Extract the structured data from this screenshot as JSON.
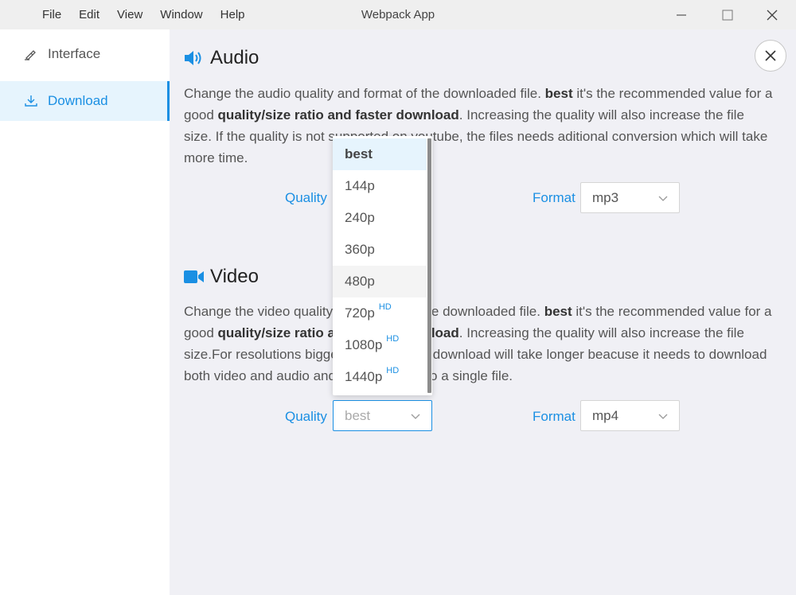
{
  "window": {
    "title": "Webpack App",
    "menu": [
      "File",
      "Edit",
      "View",
      "Window",
      "Help"
    ]
  },
  "sidebar": {
    "items": [
      {
        "label": "Interface",
        "icon": "brush-icon"
      },
      {
        "label": "Download",
        "icon": "download-icon",
        "active": true
      }
    ]
  },
  "audio": {
    "title": "Audio",
    "icon": "speaker-icon",
    "description": [
      {
        "text": "Change the audio quality and format of the downloaded file. ",
        "bold": false
      },
      {
        "text": "best",
        "bold": true
      },
      {
        "text": " it's the recommended value for a good ",
        "bold": false
      },
      {
        "text": "quality/size ratio and faster download",
        "bold": true
      },
      {
        "text": ". Increasing the quality will also increase the file size. If the quality is not supported on youtube, the files needs aditional conversion which will take more time.",
        "bold": false
      }
    ],
    "quality_label": "Quality",
    "format_label": "Format",
    "format_value": "mp3"
  },
  "video": {
    "title": "Video",
    "icon": "video-camera-icon",
    "description": [
      {
        "text": "Change the video quality and format of the downloaded file. ",
        "bold": false
      },
      {
        "text": "best",
        "bold": true
      },
      {
        "text": " it's the recommended value for a good ",
        "bold": false
      },
      {
        "text": "quality/size ratio and faster download",
        "bold": true
      },
      {
        "text": ". Increasing the quality will also increase the file size.For resolutions bigger than 720p the download will take longer beacuse it needs to download both video and audio and merge them into a single file.",
        "bold": false
      }
    ],
    "quality_label": "Quality",
    "quality_value": "best",
    "format_label": "Format",
    "format_value": "mp4"
  },
  "quality_dropdown": {
    "options": [
      {
        "label": "best",
        "hd": ""
      },
      {
        "label": "144p",
        "hd": ""
      },
      {
        "label": "240p",
        "hd": ""
      },
      {
        "label": "360p",
        "hd": ""
      },
      {
        "label": "480p",
        "hd": ""
      },
      {
        "label": "720p",
        "hd": "HD"
      },
      {
        "label": "1080p",
        "hd": "HD"
      },
      {
        "label": "1440p",
        "hd": "HD"
      }
    ],
    "selected": "best",
    "hovered": "480p"
  },
  "colors": {
    "accent": "#1a8fe3",
    "sidebar_active_bg": "#e6f4fd",
    "main_bg": "#f0f0f5"
  }
}
